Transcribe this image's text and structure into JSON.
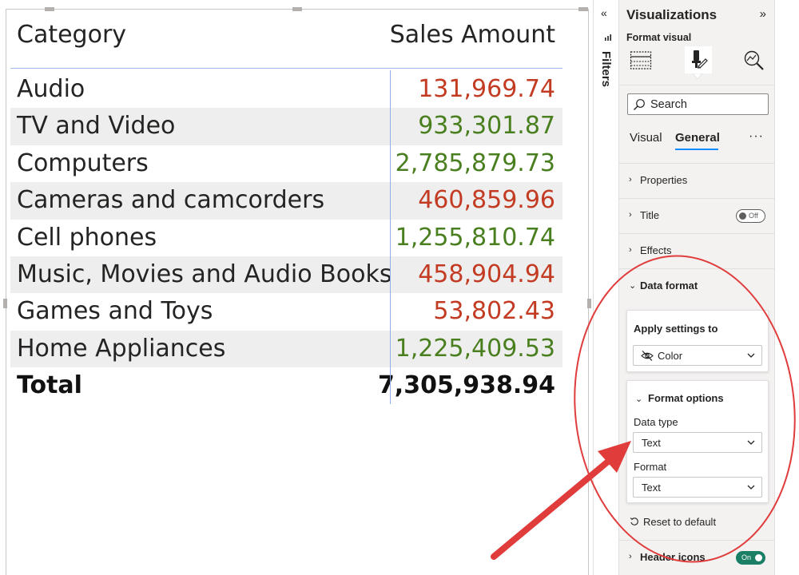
{
  "table": {
    "headers": {
      "category": "Category",
      "sales": "Sales Amount"
    },
    "rows": [
      {
        "category": "Audio",
        "value": "131,969.74",
        "color": "#c23b22"
      },
      {
        "category": "TV and Video",
        "value": "933,301.87",
        "color": "#4a7f1f"
      },
      {
        "category": "Computers",
        "value": "2,785,879.73",
        "color": "#4a7f1f"
      },
      {
        "category": "Cameras and camcorders",
        "value": "460,859.96",
        "color": "#c23b22"
      },
      {
        "category": "Cell phones",
        "value": "1,255,810.74",
        "color": "#4a7f1f"
      },
      {
        "category": "Music, Movies and Audio Books",
        "value": "458,904.94",
        "color": "#c23b22"
      },
      {
        "category": "Games and Toys",
        "value": "53,802.43",
        "color": "#c23b22"
      },
      {
        "category": "Home Appliances",
        "value": "1,225,409.53",
        "color": "#4a7f1f"
      }
    ],
    "total": {
      "category": "Total",
      "value": "7,305,938.94"
    }
  },
  "filters": {
    "label": "Filters",
    "collapse_icon": "double-chevron-left-icon"
  },
  "viz_pane": {
    "title": "Visualizations",
    "expand_icon": "double-chevron-right-icon",
    "format_visual_label": "Format visual",
    "search_placeholder": "Search",
    "tabs": {
      "visual": "Visual",
      "general": "General",
      "more": "···"
    },
    "sections": {
      "properties": "Properties",
      "title": "Title",
      "title_toggle": "Off",
      "effects": "Effects",
      "data_format": "Data format",
      "header_icons": "Header icons",
      "header_toggle": "On"
    },
    "apply_settings": {
      "label": "Apply settings to",
      "value": "Color"
    },
    "format_options": {
      "label": "Format options",
      "data_type_label": "Data type",
      "data_type_value": "Text",
      "format_label": "Format",
      "format_value": "Text"
    },
    "reset_label": "Reset to default"
  },
  "colors": {
    "accent": "#118dff",
    "negative": "#c23b22",
    "positive": "#4a7f1f",
    "annotation": "#e03c3c",
    "toggle_on": "#1a7f64"
  }
}
